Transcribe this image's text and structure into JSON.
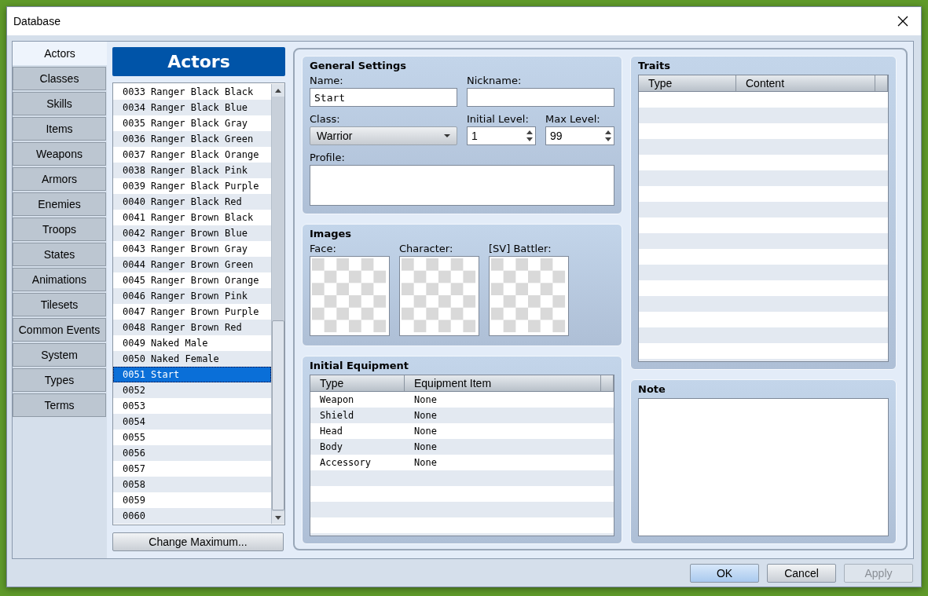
{
  "window": {
    "title": "Database"
  },
  "tabs": [
    {
      "label": "Actors",
      "selected": true
    },
    {
      "label": "Classes",
      "selected": false
    },
    {
      "label": "Skills",
      "selected": false
    },
    {
      "label": "Items",
      "selected": false
    },
    {
      "label": "Weapons",
      "selected": false
    },
    {
      "label": "Armors",
      "selected": false
    },
    {
      "label": "Enemies",
      "selected": false
    },
    {
      "label": "Troops",
      "selected": false
    },
    {
      "label": "States",
      "selected": false
    },
    {
      "label": "Animations",
      "selected": false
    },
    {
      "label": "Tilesets",
      "selected": false
    },
    {
      "label": "Common Events",
      "selected": false
    },
    {
      "label": "System",
      "selected": false
    },
    {
      "label": "Types",
      "selected": false
    },
    {
      "label": "Terms",
      "selected": false
    }
  ],
  "list": {
    "title": "Actors",
    "items": [
      {
        "label": "0033 Ranger Black Black",
        "selected": false
      },
      {
        "label": "0034 Ranger Black Blue",
        "selected": false
      },
      {
        "label": "0035 Ranger Black Gray",
        "selected": false
      },
      {
        "label": "0036 Ranger Black Green",
        "selected": false
      },
      {
        "label": "0037 Ranger Black Orange",
        "selected": false
      },
      {
        "label": "0038 Ranger Black Pink",
        "selected": false
      },
      {
        "label": "0039 Ranger Black Purple",
        "selected": false
      },
      {
        "label": "0040 Ranger Black Red",
        "selected": false
      },
      {
        "label": "0041 Ranger Brown Black",
        "selected": false
      },
      {
        "label": "0042 Ranger Brown Blue",
        "selected": false
      },
      {
        "label": "0043 Ranger Brown Gray",
        "selected": false
      },
      {
        "label": "0044 Ranger Brown Green",
        "selected": false
      },
      {
        "label": "0045 Ranger Brown Orange",
        "selected": false
      },
      {
        "label": "0046 Ranger Brown Pink",
        "selected": false
      },
      {
        "label": "0047 Ranger Brown Purple",
        "selected": false
      },
      {
        "label": "0048 Ranger Brown Red",
        "selected": false
      },
      {
        "label": "0049 Naked Male",
        "selected": false
      },
      {
        "label": "0050 Naked Female",
        "selected": false
      },
      {
        "label": "0051 Start",
        "selected": true
      },
      {
        "label": "0052",
        "selected": false
      },
      {
        "label": "0053",
        "selected": false
      },
      {
        "label": "0054",
        "selected": false
      },
      {
        "label": "0055",
        "selected": false
      },
      {
        "label": "0056",
        "selected": false
      },
      {
        "label": "0057",
        "selected": false
      },
      {
        "label": "0058",
        "selected": false
      },
      {
        "label": "0059",
        "selected": false
      },
      {
        "label": "0060",
        "selected": false
      }
    ],
    "button": "Change Maximum..."
  },
  "general_settings": {
    "title": "General Settings",
    "name": {
      "label": "Name:",
      "value": "Start"
    },
    "nickname": {
      "label": "Nickname:"
    },
    "class": {
      "label": "Class:",
      "value": "Warrior"
    },
    "initial_level": {
      "label": "Initial Level:",
      "value": "1"
    },
    "max_level": {
      "label": "Max Level:",
      "value": "99"
    },
    "profile": {
      "label": "Profile:"
    }
  },
  "images": {
    "title": "Images",
    "slots": [
      "Face:",
      "Character:",
      "[SV] Battler:"
    ]
  },
  "initial_equipment": {
    "title": "Initial Equipment",
    "columns": [
      "Type",
      "Equipment Item"
    ],
    "rows": [
      [
        "Weapon",
        "None"
      ],
      [
        "Shield",
        "None"
      ],
      [
        "Head",
        "None"
      ],
      [
        "Body",
        "None"
      ],
      [
        "Accessory",
        "None"
      ]
    ]
  },
  "traits": {
    "title": "Traits",
    "columns": [
      "Type",
      "Content"
    ]
  },
  "note": {
    "title": "Note"
  },
  "buttons": [
    {
      "label": "OK",
      "default": true,
      "disabled": false
    },
    {
      "label": "Cancel",
      "default": false,
      "disabled": false
    },
    {
      "label": "Apply",
      "default": false,
      "disabled": true
    }
  ]
}
